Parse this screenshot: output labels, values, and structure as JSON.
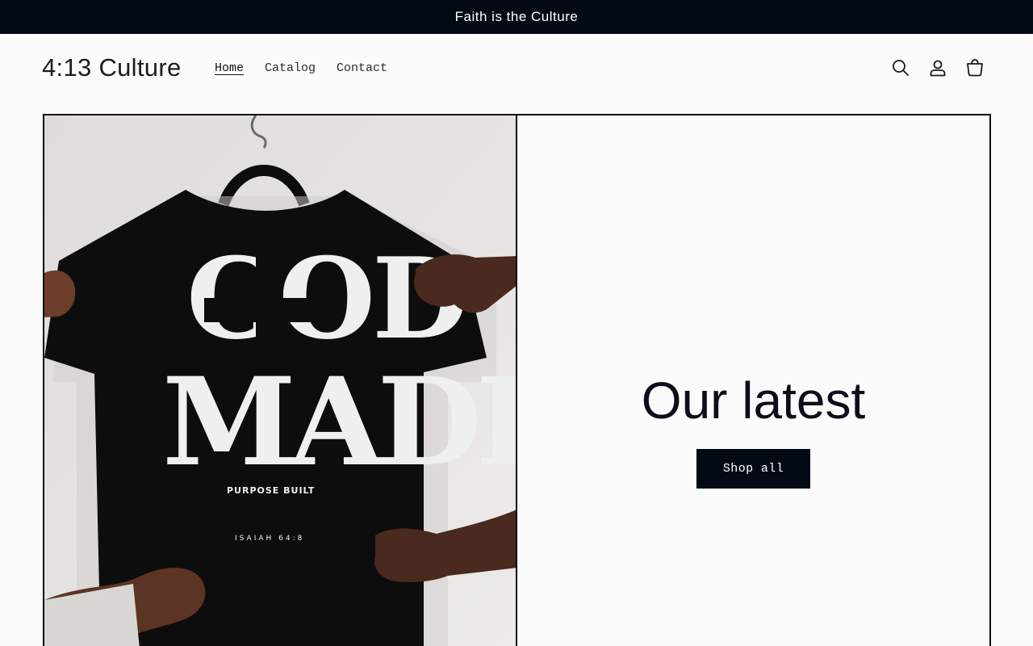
{
  "announcement": {
    "text": "Faith is the Culture"
  },
  "header": {
    "logo": "4:13 Culture",
    "nav": [
      {
        "label": "Home",
        "active": true
      },
      {
        "label": "Catalog",
        "active": false
      },
      {
        "label": "Contact",
        "active": false
      }
    ],
    "icons": [
      "search-icon",
      "account-icon",
      "cart-icon"
    ]
  },
  "banner": {
    "heading": "Our latest",
    "button_label": "Shop all",
    "image": {
      "shirt_text_main_1": "GOD",
      "shirt_text_main_2": "MADE",
      "shirt_text_sub": "PURPOSE BUILT",
      "shirt_text_verse": "ISAIAH 64:8"
    }
  },
  "colors": {
    "announcement_bg": "#030a16",
    "page_bg": "#fbfbfb",
    "button_bg": "#030a16",
    "shirt": "#0d0d0d",
    "wall": "#e4e2e1"
  }
}
